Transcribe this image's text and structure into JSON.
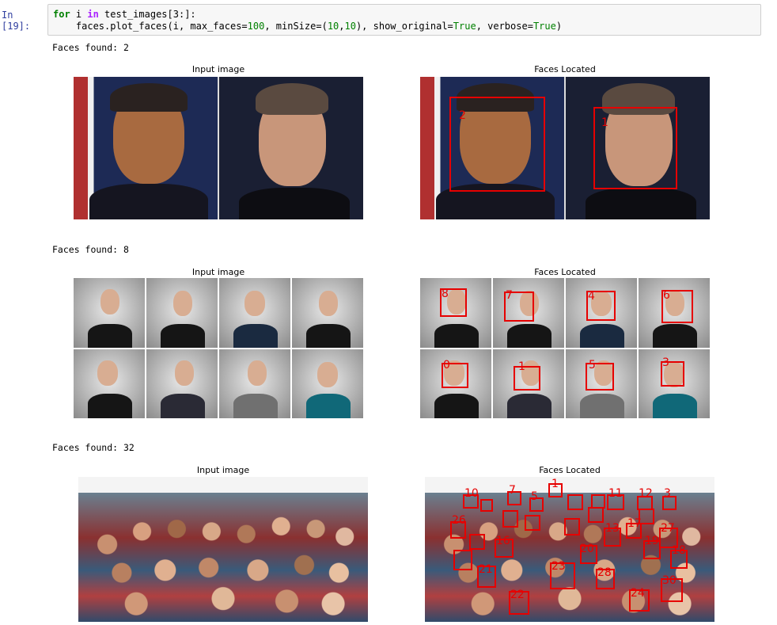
{
  "cell": {
    "prompt": "In [19]:",
    "code_line1_kw": "for",
    "code_line1_var": " i ",
    "code_line1_in": "in",
    "code_line1_rest": " test_images[3:]:",
    "code_line2_pre": "    faces.plot_faces(i, max_faces=",
    "code_line2_n1": "100",
    "code_line2_mid": ", minSize=(",
    "code_line2_n2": "10",
    "code_line2_comma": ",",
    "code_line2_n3": "10",
    "code_line2_mid2": "), show_original=",
    "code_line2_true1": "True",
    "code_line2_mid3": ", verbose=",
    "code_line2_true2": "True",
    "code_line2_end": ")"
  },
  "outputs": [
    {
      "faces_found": "Faces found: 2",
      "input_title": "Input image",
      "located_title": "Faces Located",
      "labels": [
        "2",
        "1"
      ]
    },
    {
      "faces_found": "Faces found: 8",
      "input_title": "Input image",
      "located_title": "Faces Located",
      "labels": [
        "8",
        "7",
        "4",
        "6",
        "0",
        "1",
        "5",
        "3"
      ]
    },
    {
      "faces_found": "Faces found: 32",
      "input_title": "Input image",
      "located_title": "Faces Located",
      "labels": [
        "10",
        "7",
        "1",
        "5",
        "11",
        "12",
        "3",
        "26",
        "16",
        "13",
        "17",
        "19",
        "20",
        "27",
        "18",
        "21",
        "23",
        "28",
        "30",
        "22",
        "24"
      ]
    }
  ],
  "colors": {
    "box": "#e60000",
    "code_keyword": "#008000",
    "prompt": "#303f9f"
  }
}
